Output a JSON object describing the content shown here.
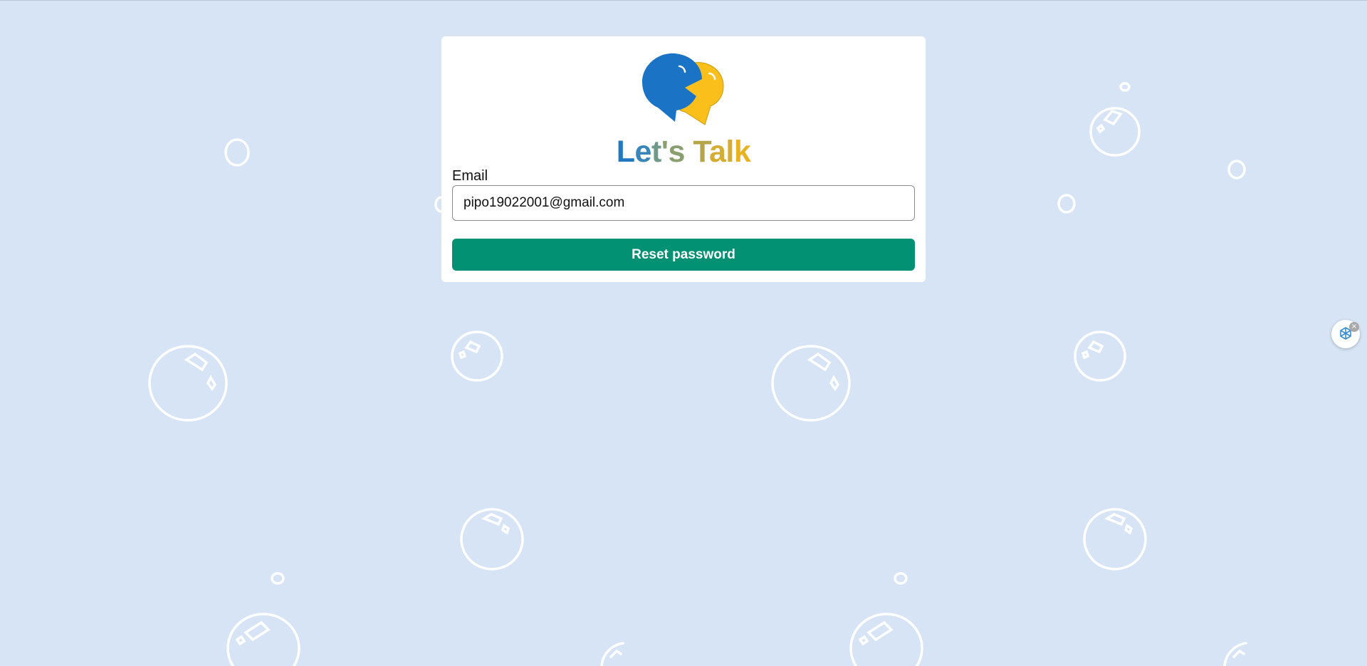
{
  "brand": {
    "name_parts": [
      "L",
      "e",
      "t",
      "'s",
      " T",
      "al",
      "k"
    ],
    "logo": "speech-bubbles-logo",
    "colors": {
      "blue": "#1a73c4",
      "yellow": "#fbbf1c"
    }
  },
  "form": {
    "email_label": "Email",
    "email_value": "pipo19022001@gmail.com",
    "submit_label": "Reset password",
    "button_color": "#029172"
  },
  "extension": {
    "icon": "openai-icon",
    "close_glyph": "×"
  },
  "background": {
    "color": "#d6e4f5",
    "pattern": "bubbles"
  }
}
